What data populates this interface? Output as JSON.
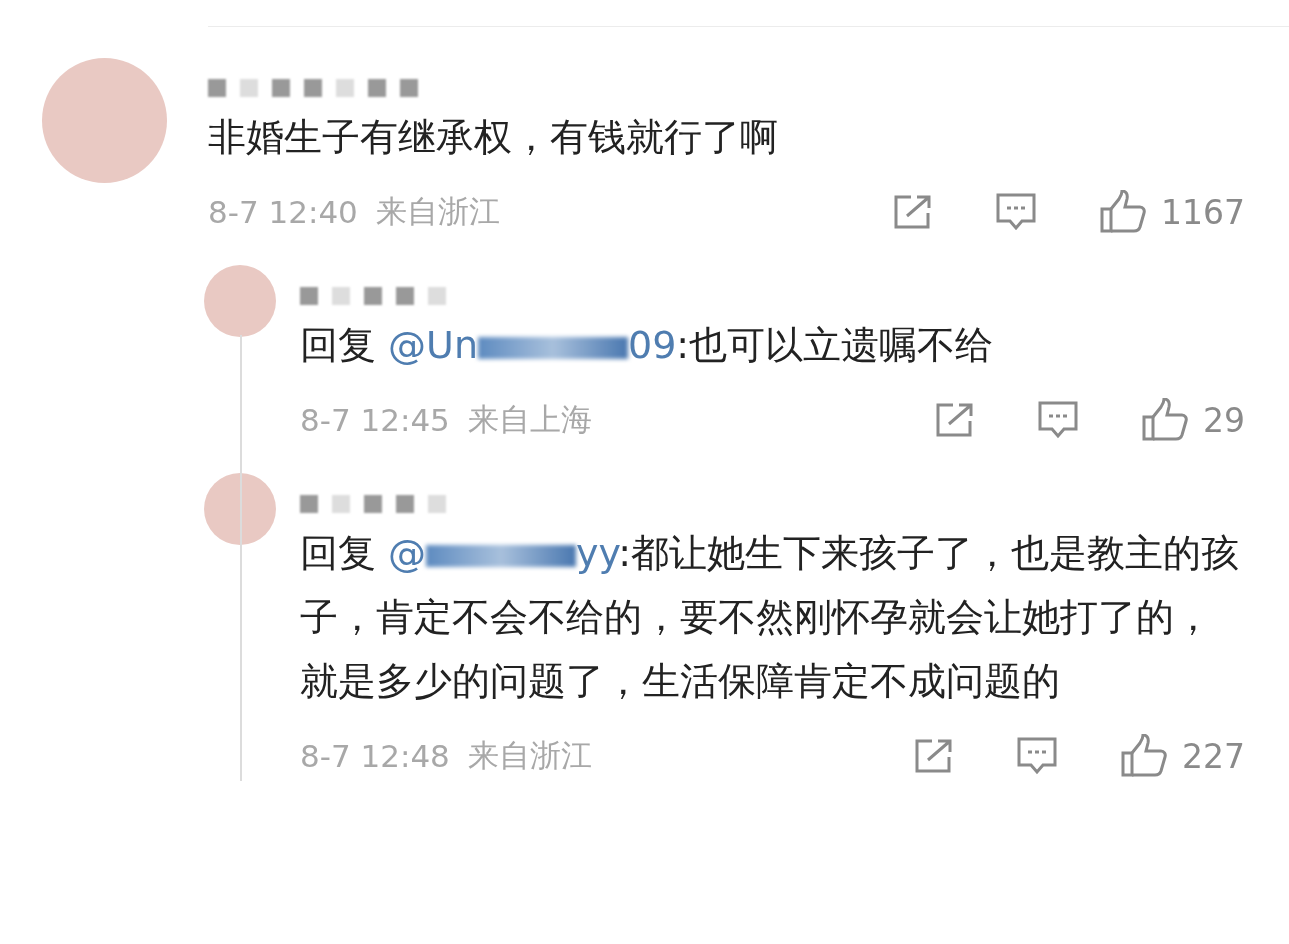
{
  "comment": {
    "text": "非婚生子有继承权，有钱就行了啊",
    "time": "8-7 12:40",
    "location": "来自浙江",
    "likes": "1167"
  },
  "replies": [
    {
      "prefix": "回复",
      "mention_start": "@Un",
      "mention_end": "09",
      "text": ":也可以立遗嘱不给",
      "time": "8-7 12:45",
      "location": "来自上海",
      "likes": "29"
    },
    {
      "prefix": "回复",
      "mention_start": "@",
      "mention_end": "yy",
      "text": ":都让她生下来孩子了，也是教主的孩子，肯定不会不给的，要不然刚怀孕就会让她打了的，就是多少的问题了，生活保障肯定不成问题的",
      "time": "8-7 12:48",
      "location": "来自浙江",
      "likes": "227"
    }
  ]
}
